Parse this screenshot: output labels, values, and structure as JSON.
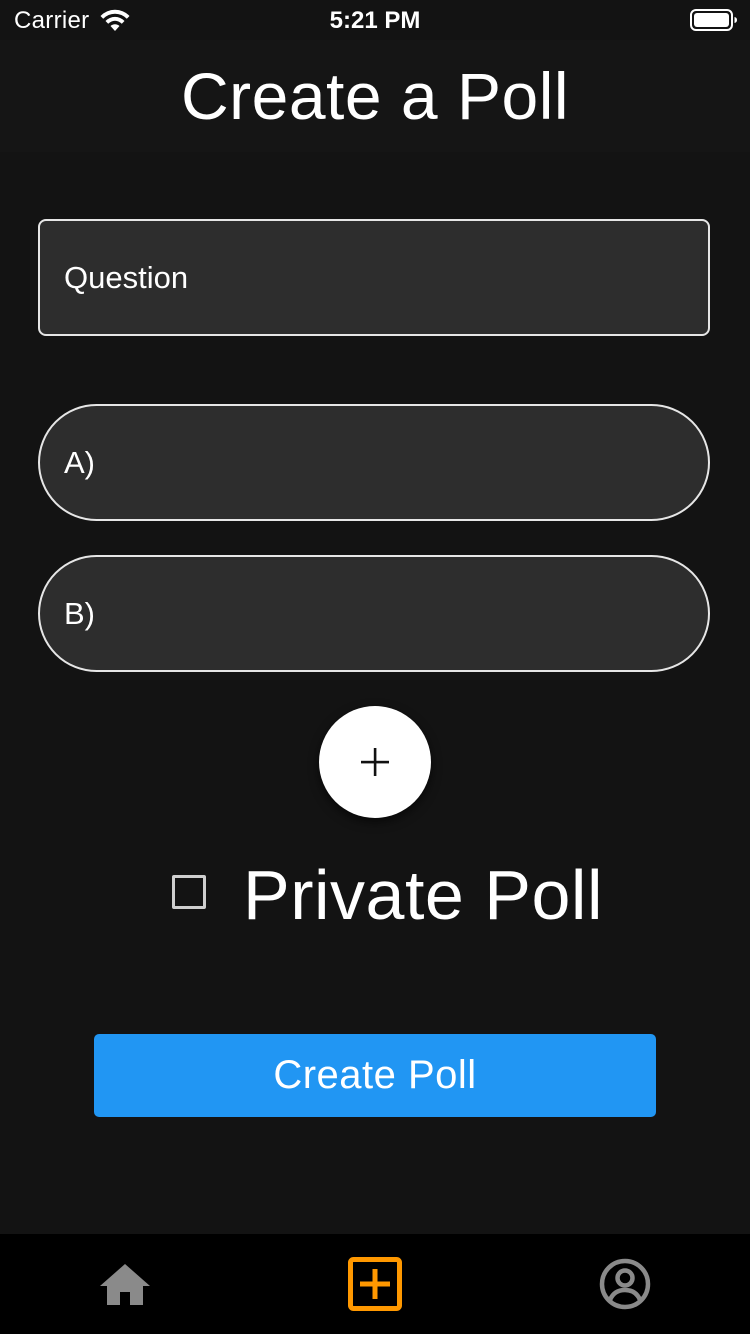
{
  "status_bar": {
    "carrier": "Carrier",
    "time": "5:21 PM"
  },
  "header": {
    "title": "Create a Poll"
  },
  "form": {
    "question_placeholder": "Question",
    "option_a_placeholder": "A)",
    "option_b_placeholder": "B)",
    "private_label": "Private Poll",
    "private_checked": false,
    "submit_label": "Create Poll"
  },
  "icons": {
    "add": "plus-icon",
    "home": "home-icon",
    "create": "add-box-icon",
    "profile": "account-circle-icon"
  },
  "bottom_nav": {
    "active": "create"
  },
  "colors": {
    "background": "#131313",
    "field_fill": "#2d2d2d",
    "accent_blue": "#2196f3",
    "active_tab": "#ff9800",
    "inactive_tab": "#8a8a8a"
  }
}
